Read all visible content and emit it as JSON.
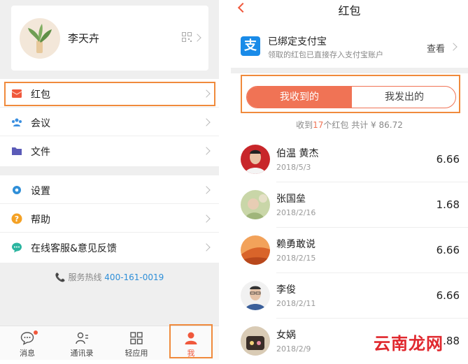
{
  "profile": {
    "name": "李天卉"
  },
  "menu_group1": [
    {
      "label": "红包",
      "icon": "red-envelope-icon",
      "color": "#f0583c"
    },
    {
      "label": "会议",
      "icon": "people-icon",
      "color": "#3a8fe0"
    },
    {
      "label": "文件",
      "icon": "folder-icon",
      "color": "#5b5bb8"
    }
  ],
  "menu_group2": [
    {
      "label": "设置",
      "icon": "gear-icon",
      "color": "#2f8fd8"
    },
    {
      "label": "帮助",
      "icon": "help-icon",
      "color": "#f4a124"
    },
    {
      "label": "在线客服&意见反馈",
      "icon": "chat-icon",
      "color": "#2bb5a0"
    }
  ],
  "hotline": {
    "label": "服务热线",
    "number": "400-161-0019"
  },
  "tabbar": [
    {
      "label": "消息",
      "icon": "message-icon"
    },
    {
      "label": "通讯录",
      "icon": "contacts-icon"
    },
    {
      "label": "轻应用",
      "icon": "apps-grid-icon"
    },
    {
      "label": "我",
      "icon": "person-icon"
    }
  ],
  "nav": {
    "title": "红包"
  },
  "alipay": {
    "title": "已绑定支付宝",
    "subtitle": "领取的红包已直接存入支付宝账户",
    "action": "查看",
    "logo_char": "支",
    "color": "#1a8be8"
  },
  "segments": {
    "received": "我收到的",
    "sent": "我发出的"
  },
  "summary": {
    "prefix": "收到",
    "count": "17",
    "middle": "个红包 共计 ¥ 86.72"
  },
  "envelopes": [
    {
      "name": "伯温 黄杰",
      "date": "2018/5/3",
      "amount": "6.66"
    },
    {
      "name": "张国垒",
      "date": "2018/2/16",
      "amount": "1.68"
    },
    {
      "name": "赖勇敢说",
      "date": "2018/2/15",
      "amount": "6.66"
    },
    {
      "name": "李俊",
      "date": "2018/2/11",
      "amount": "6.66"
    },
    {
      "name": "女娲",
      "date": "2018/2/9",
      "amount": "3.88"
    }
  ],
  "watermark": "云南龙网",
  "accent": "#f07355"
}
